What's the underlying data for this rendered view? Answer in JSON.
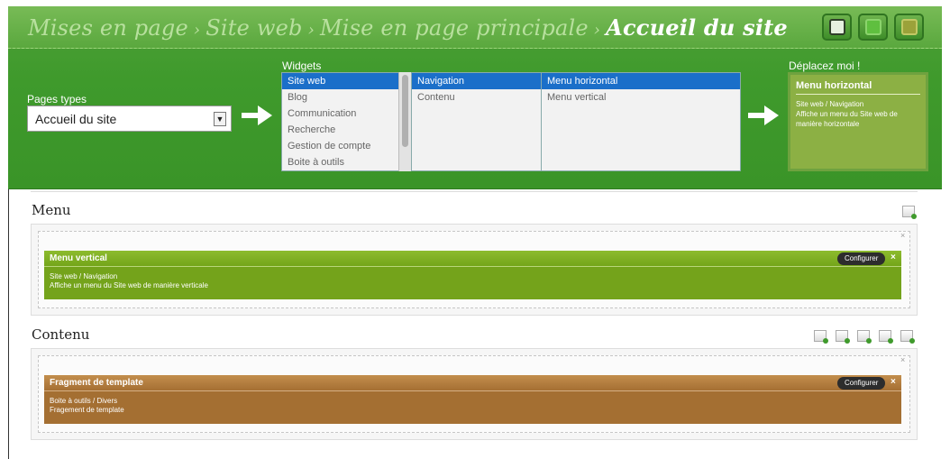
{
  "breadcrumb": {
    "items": [
      "Mises en page",
      "Site web",
      "Mise en page principale"
    ],
    "separator": "›",
    "current": "Accueil du site"
  },
  "toolbar": {
    "buttons": [
      {
        "name": "save",
        "icon": "floppy-icon"
      },
      {
        "name": "copy",
        "icon": "copy-icon"
      },
      {
        "name": "edit",
        "icon": "edit-icon"
      }
    ]
  },
  "page_types": {
    "label": "Pages types",
    "selected": "Accueil du site"
  },
  "widgets": {
    "label": "Widgets",
    "categories": [
      "Site web",
      "Blog",
      "Communication",
      "Recherche",
      "Gestion de compte",
      "Boite à outils"
    ],
    "subcategories": [
      "Navigation",
      "Contenu"
    ],
    "items": [
      "Menu horizontal",
      "Menu vertical"
    ]
  },
  "drag_preview": {
    "label": "Déplacez moi !",
    "title": "Menu horizontal",
    "line1": "Site web / Navigation",
    "line2": "Affiche un menu du Site web de manière horizontale"
  },
  "sections": {
    "menu": {
      "title": "Menu",
      "widget_title": "Menu vertical",
      "widget_line1": "Site web / Navigation",
      "widget_line2": "Affiche un menu du Site web de manière verticale",
      "configure": "Configurer",
      "close": "×"
    },
    "content": {
      "title": "Contenu",
      "widget_title": "Fragment de template",
      "widget_line1": "Boite à outils / Divers",
      "widget_line2": "Fragement de template",
      "configure": "Configurer",
      "close": "×"
    }
  },
  "colors": {
    "header_green": "#3f9a2c",
    "selection_blue": "#1b6fc9",
    "widget_green": "#74a31b",
    "widget_brown": "#a46f32"
  }
}
